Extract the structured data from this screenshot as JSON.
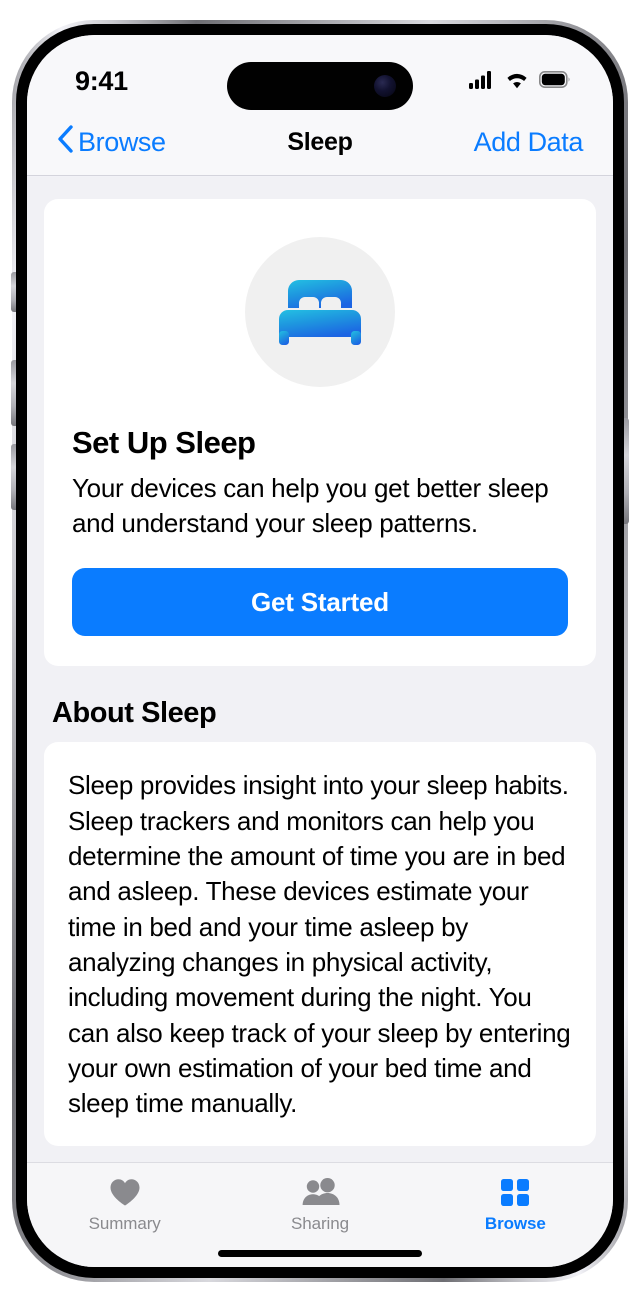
{
  "status_bar": {
    "time": "9:41",
    "cellular_icon": "cellular-signal-icon",
    "wifi_icon": "wifi-icon",
    "battery_icon": "battery-full-icon"
  },
  "nav_bar": {
    "back_label": "Browse",
    "back_icon": "chevron-left-icon",
    "title": "Sleep",
    "action_label": "Add Data"
  },
  "setup_card": {
    "icon": "bed-icon",
    "title": "Set Up Sleep",
    "description": "Your devices can help you get better sleep and understand your sleep patterns.",
    "button_label": "Get Started"
  },
  "about_section": {
    "heading": "About Sleep",
    "body": "Sleep provides insight into your sleep habits. Sleep trackers and monitors can help you determine the amount of time you are in bed and asleep. These devices estimate your time in bed and your time asleep by analyzing changes in physical activity, including movement during the night. You can also keep track of your sleep by entering your own estimation of your bed time and sleep time manually."
  },
  "tab_bar": {
    "tabs": [
      {
        "label": "Summary",
        "icon": "heart-icon",
        "active": false
      },
      {
        "label": "Sharing",
        "icon": "people-icon",
        "active": false
      },
      {
        "label": "Browse",
        "icon": "grid-icon",
        "active": true
      }
    ]
  },
  "colors": {
    "accent_blue": "#0A7CFF",
    "inactive_gray": "#8A8A8E",
    "page_background": "#F1F1F5",
    "card_background": "#FFFFFF",
    "icon_circle": "#F0F0F0",
    "bed_gradient_start": "#22B8E0",
    "bed_gradient_end": "#1C6FE0"
  }
}
